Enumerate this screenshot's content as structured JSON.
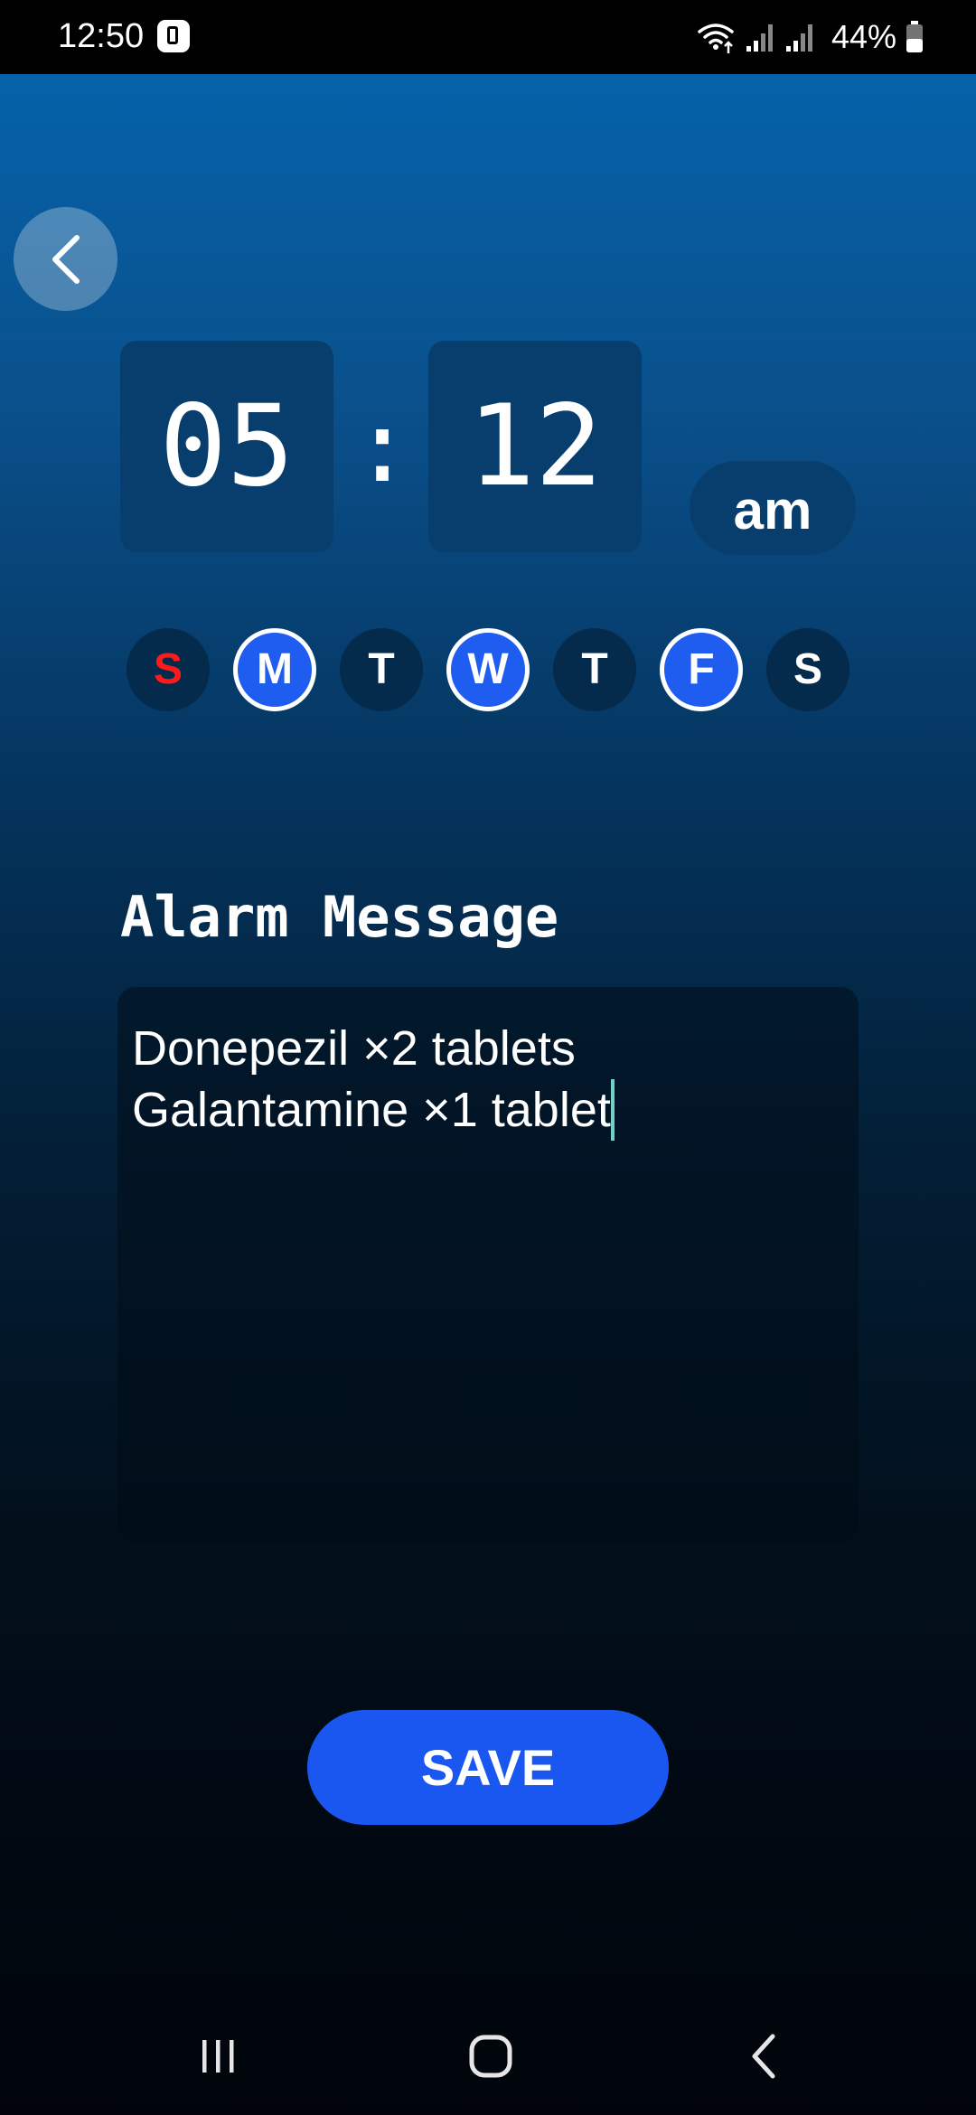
{
  "status_bar": {
    "time": "12:50",
    "battery": "44%"
  },
  "alarm": {
    "hour": "05",
    "separator": ":",
    "minute": "12",
    "period": "am"
  },
  "days": [
    {
      "label": "S",
      "selected": false
    },
    {
      "label": "M",
      "selected": true
    },
    {
      "label": "T",
      "selected": false
    },
    {
      "label": "W",
      "selected": true
    },
    {
      "label": "T",
      "selected": false
    },
    {
      "label": "F",
      "selected": true
    },
    {
      "label": "S",
      "selected": false
    }
  ],
  "message": {
    "label": "Alarm Message",
    "line1": "Donepezil ×2 tablets",
    "line2": "Galantamine ×1 tablet"
  },
  "save_label": "SAVE",
  "colors": {
    "accent": "#1a57f0",
    "sunday": "#ff1a1a",
    "caret": "#6fd3c9"
  },
  "icons": {
    "back": "chevron-left-icon",
    "nav_recents": "recents-icon",
    "nav_home": "home-icon",
    "nav_back": "back-icon"
  }
}
